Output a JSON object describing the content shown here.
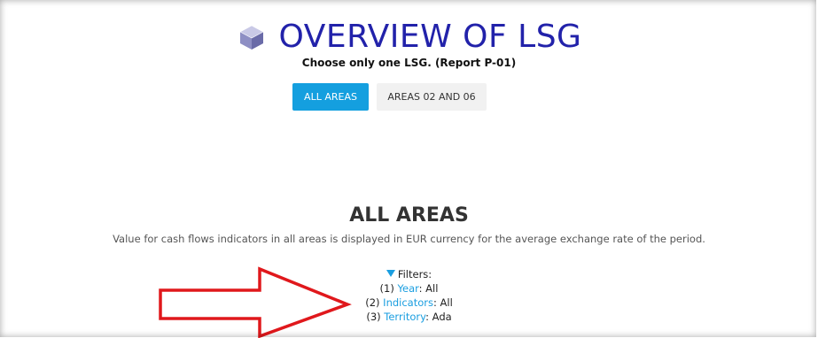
{
  "header": {
    "title": "OVERVIEW OF LSG",
    "subtitle": "Choose only one LSG. (Report P-01)",
    "icon": "cube-icon"
  },
  "tabs": [
    {
      "label": "ALL AREAS",
      "active": true
    },
    {
      "label": "AREAS 02 AND 06",
      "active": false
    }
  ],
  "section": {
    "title": "ALL AREAS",
    "description": "Value for cash flows indicators in all areas is displayed in EUR currency for the average exchange rate of the period."
  },
  "filters": {
    "label": "Filters:",
    "items": [
      {
        "prefix": "(1) ",
        "name": "Year",
        "value": ": All"
      },
      {
        "prefix": "(2) ",
        "name": "Indicators",
        "value": ": All"
      },
      {
        "prefix": "(3) ",
        "name": "Territory",
        "value": ": Ada"
      }
    ]
  },
  "annotation": {
    "icon": "red-arrow-icon",
    "color": "#e0181c"
  },
  "colors": {
    "title": "#2222aa",
    "accent": "#149fdf",
    "link": "#1a9ee0"
  }
}
